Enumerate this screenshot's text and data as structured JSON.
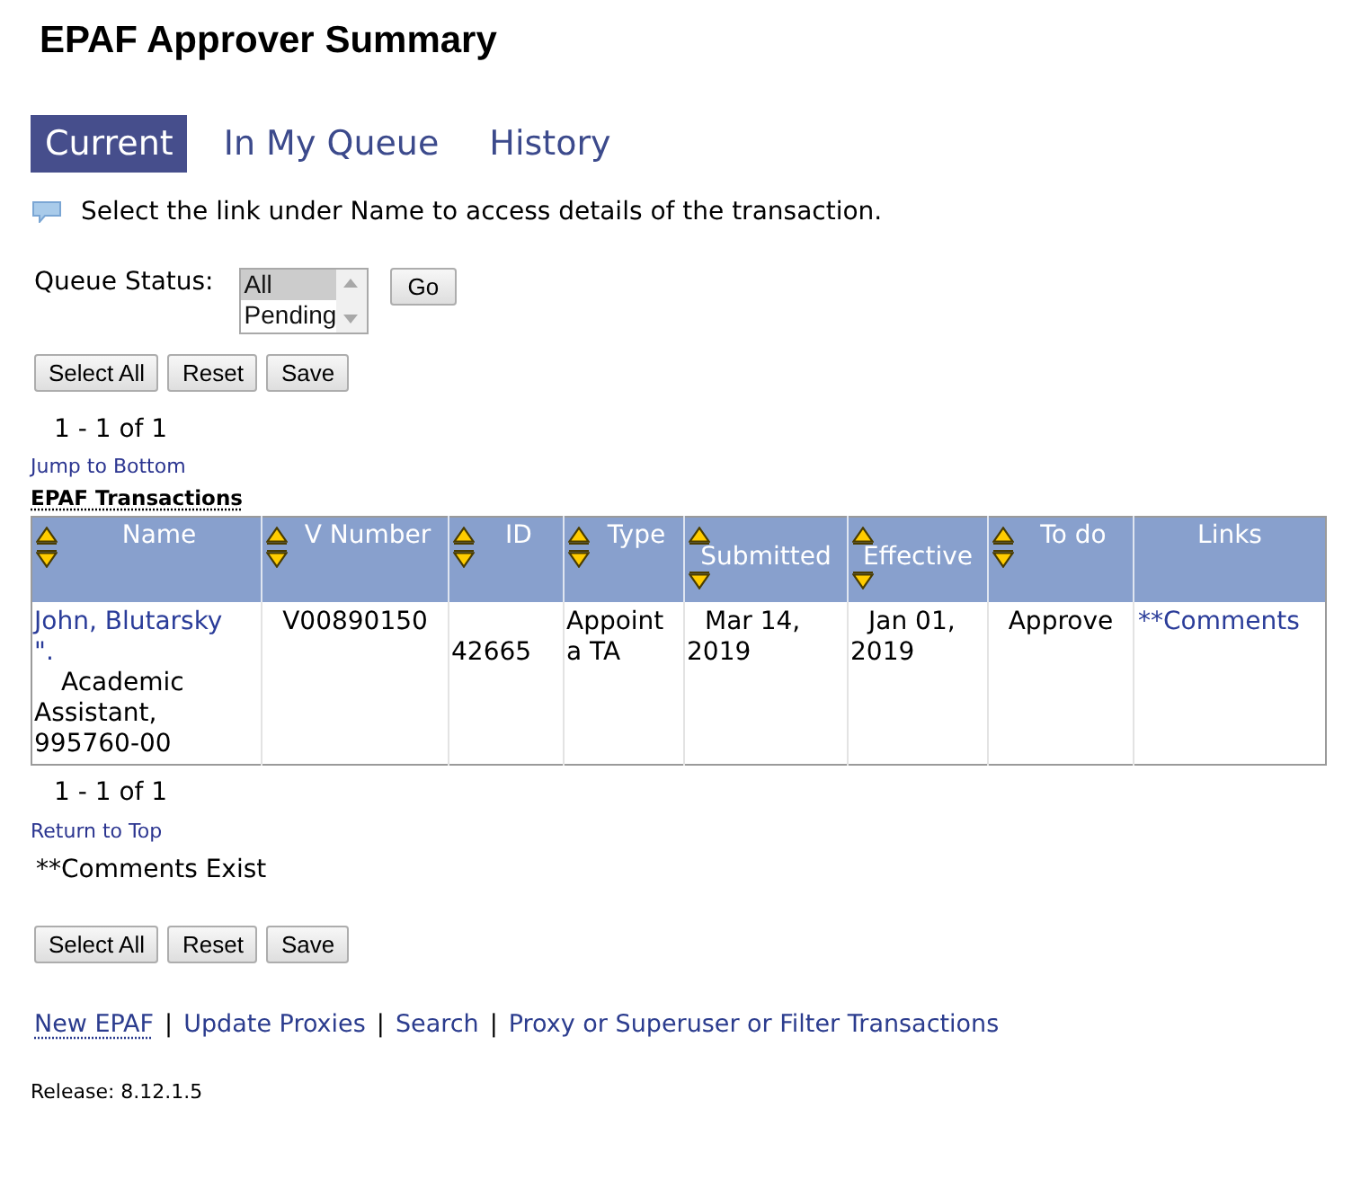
{
  "page_title": "EPAF Approver Summary",
  "tabs": [
    {
      "label": "Current",
      "selected": true
    },
    {
      "label": "In My Queue",
      "selected": false
    },
    {
      "label": "History",
      "selected": false
    }
  ],
  "info": {
    "text": "Select the link under Name to access details of the transaction."
  },
  "queue_status": {
    "label": "Queue Status:",
    "options": [
      {
        "label": "All",
        "selected": true
      },
      {
        "label": "Pending",
        "selected": false
      }
    ],
    "button": "Go"
  },
  "top_buttons": [
    "Select All",
    "Reset",
    "Save"
  ],
  "top_pagination": "1 - 1 of 1",
  "jump_link": "Jump to Bottom",
  "table": {
    "caption": "EPAF Transactions",
    "columns": [
      {
        "label": "Name",
        "sortable": true
      },
      {
        "label": "V Number",
        "sortable": true
      },
      {
        "label": "ID",
        "sortable": true
      },
      {
        "label": "Type",
        "sortable": true
      },
      {
        "label": "Submitted",
        "sortable": true
      },
      {
        "label": "Effective",
        "sortable": true
      },
      {
        "label": "To do",
        "sortable": true
      },
      {
        "label": "Links",
        "sortable": false
      }
    ],
    "rows": [
      {
        "name": "John, Blutarsky \".",
        "position": "Academic Assistant, 995760-00",
        "v_number": "V00890150",
        "id": "42665",
        "type": "Appoint a TA",
        "submitted": "Mar 14, 2019",
        "effective": "Jan 01, 2019",
        "to_do": "Approve",
        "links": "**Comments"
      }
    ]
  },
  "bottom_pagination": "1 - 1 of 1",
  "return_link": "Return to Top",
  "legend": "**Comments Exist",
  "bottom_buttons": [
    "Select All",
    "Reset",
    "Save"
  ],
  "footer": {
    "links": [
      {
        "label": "New EPAF",
        "focused": true
      },
      {
        "label": "Update Proxies",
        "focused": false
      },
      {
        "label": "Search",
        "focused": false
      },
      {
        "label": "Proxy or Superuser or Filter Transactions",
        "focused": false
      }
    ],
    "separators": [
      "|",
      "|",
      "|"
    ]
  },
  "release": "Release: 8.12.1.5"
}
